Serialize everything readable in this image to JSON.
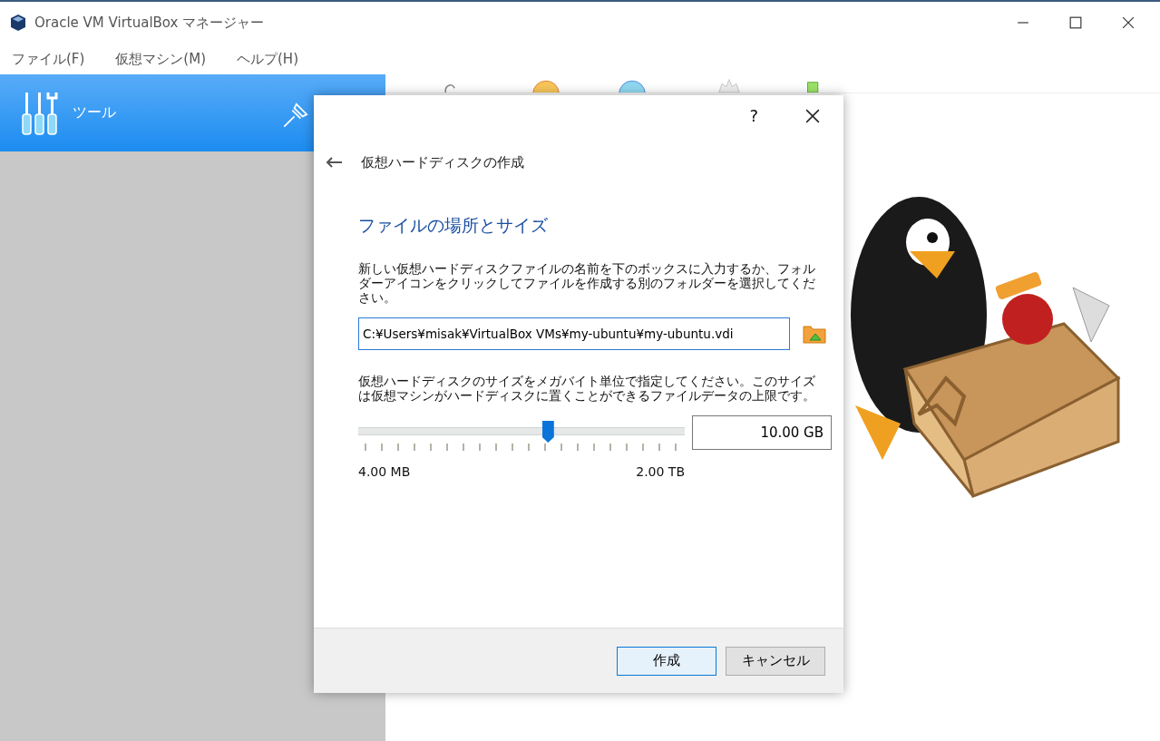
{
  "window": {
    "title": "Oracle VM VirtualBox マネージャー"
  },
  "menu": [
    {
      "label": "ファイル(F)"
    },
    {
      "label": "仮想マシン(M)"
    },
    {
      "label": "ヘルプ(H)"
    }
  ],
  "sidebar": {
    "header": {
      "label": "ツール",
      "selected": true
    }
  },
  "dialog": {
    "help": "?",
    "title": "仮想ハードディスクの作成",
    "heading": "ファイルの場所とサイズ",
    "location_text": "新しい仮想ハードディスクファイルの名前を下のボックスに入力するか、フォルダーアイコンをクリックしてファイルを作成する別のフォルダーを選択してください。",
    "location": {
      "value": "C:¥Users¥misak¥VirtualBox VMs¥my-ubuntu¥my-ubuntu.vdi"
    },
    "size_text": "仮想ハードディスクのサイズをメガバイト単位で指定してください。このサイズは仮想マシンがハードディスクに置くことができるファイルデータの上限です。",
    "size_slider": {
      "level": 0.58,
      "min_label": "4.00 MB",
      "max_label": "2.00 TB"
    },
    "size": {
      "value": "10.00 GB"
    },
    "buttons": [
      {
        "label": "作成",
        "kind": "default"
      },
      {
        "label": "キャンセル",
        "kind": "normal"
      }
    ]
  }
}
